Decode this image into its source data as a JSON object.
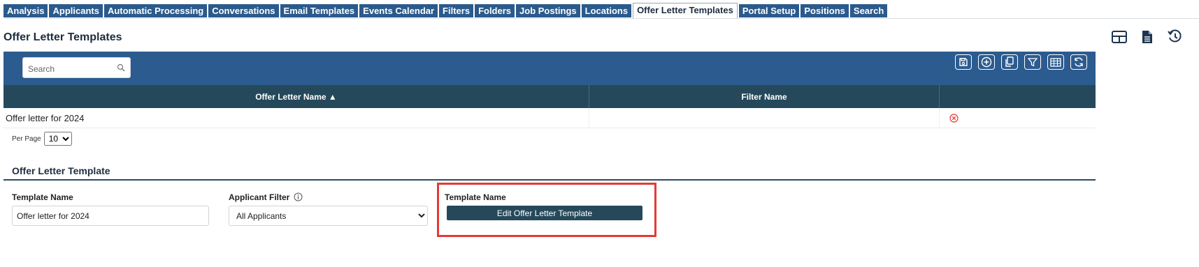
{
  "tabs": [
    {
      "label": "Analysis"
    },
    {
      "label": "Applicants"
    },
    {
      "label": "Automatic Processing"
    },
    {
      "label": "Conversations"
    },
    {
      "label": "Email Templates"
    },
    {
      "label": "Events Calendar"
    },
    {
      "label": "Filters"
    },
    {
      "label": "Folders"
    },
    {
      "label": "Job Postings"
    },
    {
      "label": "Locations"
    },
    {
      "label": "Offer Letter Templates"
    },
    {
      "label": "Portal Setup"
    },
    {
      "label": "Positions"
    },
    {
      "label": "Search"
    }
  ],
  "active_tab": "Offer Letter Templates",
  "page_title": "Offer Letter Templates",
  "header_icons": [
    "layout-grid-icon",
    "document-icon",
    "history-icon"
  ],
  "search": {
    "placeholder": "Search"
  },
  "toolbar_icons": [
    "save-icon",
    "add-icon",
    "copy-icon",
    "filter-icon",
    "columns-icon",
    "refresh-icon"
  ],
  "table": {
    "columns": [
      "Offer Letter Name ▲",
      "Filter Name",
      ""
    ],
    "rows": [
      {
        "name": "Offer letter for 2024",
        "filter": ""
      }
    ]
  },
  "pagination": {
    "per_page_label": "Per Page",
    "per_page_value": "10",
    "options": [
      "10"
    ]
  },
  "form": {
    "section_title": "Offer Letter Template",
    "template_name_label": "Template Name",
    "template_name_value": "Offer letter for 2024",
    "applicant_filter_label": "Applicant Filter",
    "applicant_filter_value": "All Applicants",
    "template_label": "Template Name",
    "edit_button": "Edit Offer Letter Template"
  },
  "colors": {
    "tab_bg": "#2b5a8c",
    "bar_bg": "#2c5b8f",
    "table_header_bg": "#25495a",
    "highlight": "#e53935",
    "delete_icon": "#e53935"
  }
}
